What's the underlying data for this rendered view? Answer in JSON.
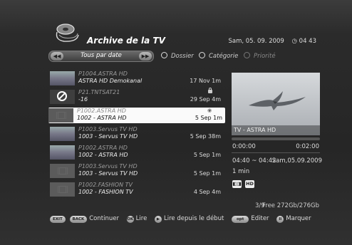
{
  "header": {
    "title": "Archive de la TV",
    "date": "Sam, 05. 09. 2009",
    "clock_icon": "clock-icon",
    "time": "04 43"
  },
  "filters": {
    "sort_label": "Tous par date",
    "options": [
      {
        "label": "Dossier",
        "active": true
      },
      {
        "label": "Catégorie",
        "active": true
      },
      {
        "label": "Priorité",
        "active": false
      }
    ]
  },
  "recordings": [
    {
      "line1": "P1004.ASTRA HD",
      "line2": "ASTRA HD Demokanal",
      "time": "17 Nov 1m",
      "thumb": "lake",
      "icon": "",
      "selected": false
    },
    {
      "line1": "P21.TNTSAT21",
      "line2": "-16",
      "time": "29 Sep 4m",
      "thumb": "blocked",
      "icon": "lock-icon",
      "selected": false
    },
    {
      "line1": "P1002.ASTRA HD",
      "line2": "1002 - ASTRA HD",
      "time": "5 Sep 1m",
      "thumb": "film",
      "icon": "recording-icon",
      "selected": true
    },
    {
      "line1": "P1003.Servus TV HD",
      "line2": "1003 - Servus TV HD",
      "time": "5 Sep 38m",
      "thumb": "lake",
      "icon": "",
      "selected": false
    },
    {
      "line1": "P1002.ASTRA HD",
      "line2": "1002 - ASTRA HD",
      "time": "5 Sep 1m",
      "thumb": "lake",
      "icon": "",
      "selected": false
    },
    {
      "line1": "P1003.Servus TV HD",
      "line2": "1003 - Servus TV HD",
      "time": "5 Sep 1m",
      "thumb": "film",
      "icon": "",
      "selected": false
    },
    {
      "line1": "P1002.FASHION TV",
      "line2": "1002 - FASHION TV",
      "time": "4 Sep 4m",
      "thumb": "film",
      "icon": "",
      "selected": false
    }
  ],
  "preview": {
    "channel": "TV - ASTRA HD",
    "progress": 0.0,
    "start": "0:00:00",
    "end": "0:02:00",
    "span": "04:40 ~ 04:42",
    "date": "Sam,05.09.2009",
    "duration": "1 min",
    "badges": [
      "dolby-icon",
      "HD"
    ]
  },
  "storage": {
    "counter": "3/9",
    "free": "Free 272Gb/276Gb"
  },
  "footer": {
    "items": [
      {
        "key": "EXIT",
        "label": ""
      },
      {
        "key": "BACK",
        "label": "Continuer"
      },
      {
        "key": "OK",
        "label": "Lire"
      },
      {
        "key": "▶",
        "label": "Lire depuis le début"
      },
      {
        "key": "opt",
        "label": "Editer"
      },
      {
        "key": "II",
        "label": "Marquer"
      }
    ]
  }
}
